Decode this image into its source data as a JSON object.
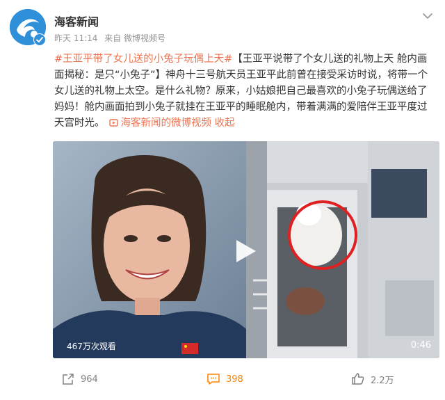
{
  "post": {
    "author": "海客新闻",
    "time": "昨天 11:14",
    "source": "来自 微博视频号",
    "content": {
      "hashtag": "#王亚平带了女儿送的小兔子玩偶上天#",
      "body": "【王亚平说带了个女儿送的礼物上天 舱内画面揭秘：是只“小兔子”】神舟十三号航天员王亚平此前曾在接受采访时说，将带一个女儿送的礼物上太空。是什么礼物？原来，小姑娘把自己最喜欢的小兔子玩偶送给了妈妈！舱内画面拍到小兔子就挂在王亚平的睡眠舱内，带着满满的爱陪伴王亚平度过天宫时光。",
      "link_text": "海客新闻的微博视频",
      "collapse": "收起"
    },
    "video": {
      "views": "467万次观看",
      "duration": "0:46"
    },
    "actions": {
      "reposts": "964",
      "comments": "398",
      "likes": "2.2万"
    }
  },
  "icons": {
    "avatar": "haike-news-logo",
    "verified": "verified-badge-icon",
    "menu": "chevron-down-icon",
    "link": "video-link-icon",
    "play": "play-icon",
    "repost": "repost-icon",
    "comment": "comment-icon",
    "like": "like-icon"
  },
  "colors": {
    "accent": "#eb7350",
    "comment_active": "#ff8200",
    "verified": "#2f8fd8"
  }
}
